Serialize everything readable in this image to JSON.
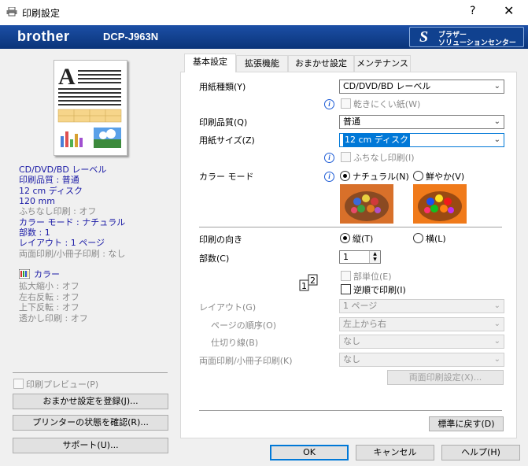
{
  "window": {
    "title": "印刷設定",
    "help": "?",
    "close": "✕"
  },
  "brand": {
    "logo": "brother",
    "model": "DCP-J963N",
    "solution_line1": "ブラザー",
    "solution_line2": "ソリューションセンター",
    "solution_mark": "S"
  },
  "summary": {
    "lines": [
      "CD/DVD/BD レーベル",
      "印刷品質 : 普通",
      "12 cm ディスク",
      "120 mm",
      "ふちなし印刷 : オフ",
      "カラー モード : ナチュラル",
      "部数 : 1",
      "レイアウト : 1 ページ",
      "両面印刷/小冊子印刷 : なし"
    ],
    "color_label": "カラー",
    "color_lines": [
      "拡大縮小 : オフ",
      "左右反転 : オフ",
      "上下反転 : オフ",
      "透かし印刷 : オフ"
    ]
  },
  "left": {
    "preview_checkbox": "印刷プレビュー(P)",
    "save_button": "おまかせ設定を登録(J)...",
    "status_button": "プリンターの状態を確認(R)...",
    "support_button": "サポート(U)..."
  },
  "tabs": [
    "基本設定",
    "拡張機能",
    "おまかせ設定",
    "メンテナンス"
  ],
  "form": {
    "media_label": "用紙種類(Y)",
    "media_value": "CD/DVD/BD レーベル",
    "slow_dry": "乾きにくい紙(W)",
    "quality_label": "印刷品質(Q)",
    "quality_value": "普通",
    "size_label": "用紙サイズ(Z)",
    "size_value": "12 cm ディスク",
    "borderless": "ふちなし印刷(I)",
    "color_mode_label": "カラー モード",
    "color_natural": "ナチュラル(N)",
    "color_vivid": "鮮やか(V)",
    "orientation_label": "印刷の向き",
    "portrait": "縦(T)",
    "landscape": "横(L)",
    "copies_label": "部数(C)",
    "copies_value": "1",
    "collate": "部単位(E)",
    "reverse": "逆順で印刷(I)",
    "layout_label": "レイアウト(G)",
    "layout_value": "1 ページ",
    "order_label": "ページの順序(O)",
    "order_value": "左上から右",
    "border_label": "仕切り線(B)",
    "border_value": "なし",
    "duplex_label": "両面印刷/小冊子印刷(K)",
    "duplex_value": "なし",
    "duplex_settings": "両面印刷設定(X)...",
    "default_button": "標準に戻す(D)"
  },
  "footer": {
    "ok": "OK",
    "cancel": "キャンセル",
    "help": "ヘルプ(H)"
  }
}
